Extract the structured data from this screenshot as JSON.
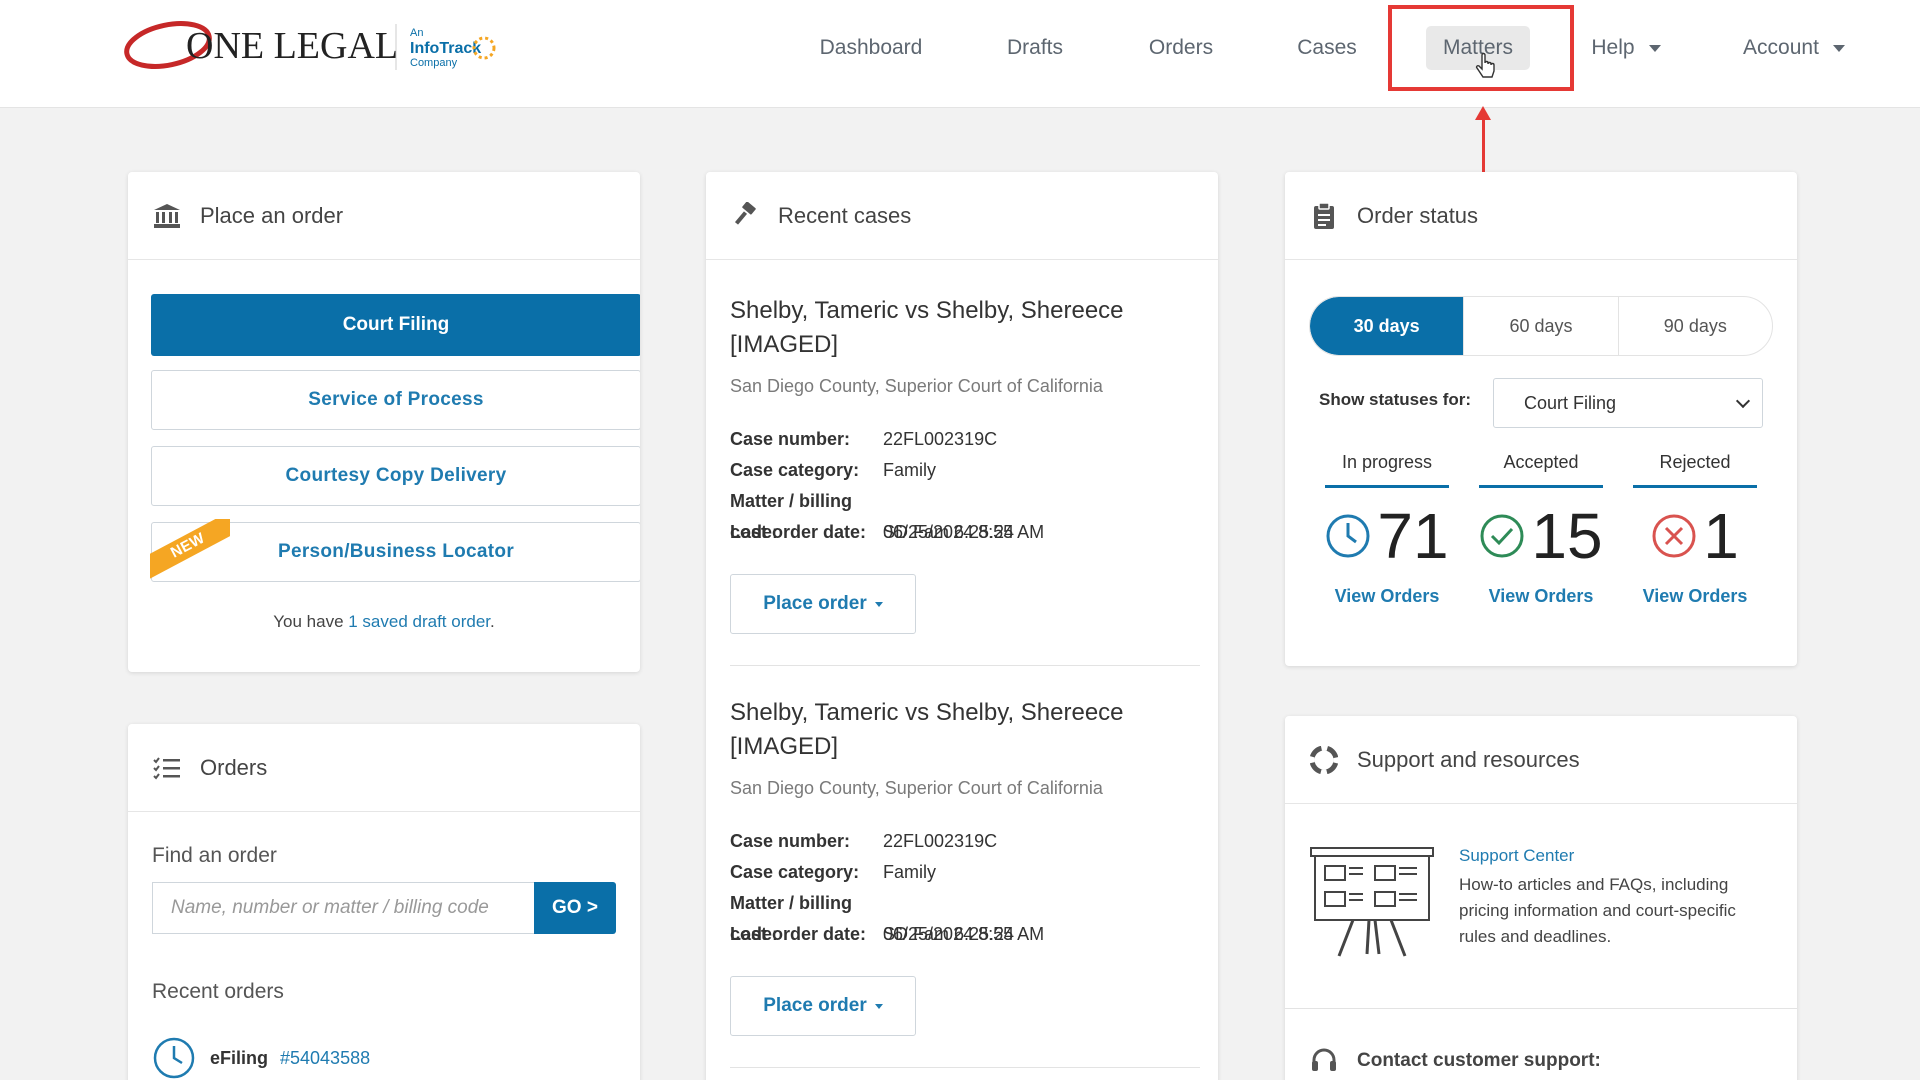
{
  "brand": {
    "logo_text": "ONE LEGAL",
    "partner_line1": "An",
    "partner_name": "InfoTrack",
    "partner_line2": "Company"
  },
  "nav": {
    "items": [
      "Dashboard",
      "Drafts",
      "Orders",
      "Cases",
      "Matters"
    ],
    "help": "Help",
    "account": "Account",
    "active": "Matters"
  },
  "place_order": {
    "title": "Place an order",
    "buttons": [
      "Court Filing",
      "Service of Process",
      "Courtesy Copy Delivery",
      "Person/Business Locator"
    ],
    "new_badge": "NEW",
    "saved_prefix": "You have ",
    "saved_link": "1 saved draft order",
    "saved_suffix": "."
  },
  "orders": {
    "title": "Orders",
    "find_label": "Find an order",
    "search_placeholder": "Name, number or matter / billing code",
    "go_label": "GO >",
    "recent_label": "Recent orders",
    "recent": [
      {
        "type": "eFiling",
        "number": "#54043588"
      }
    ]
  },
  "recent_cases": {
    "title": "Recent cases",
    "field_labels": {
      "case_number": "Case number:",
      "case_category": "Case category:",
      "matter_code": "Matter / billing code:",
      "last_order": "Last order date:"
    },
    "place_order_label": "Place order",
    "cases": [
      {
        "title": "Shelby, Tameric vs Shelby, Shereece [IMAGED]",
        "court": "San Diego County, Superior Court of California",
        "case_number": "22FL002319C",
        "case_category": "Family",
        "matter_code": "SD Fam 6.25.24",
        "last_order": "06/25/2024 8:55 AM"
      },
      {
        "title": "Shelby, Tameric vs Shelby, Shereece [IMAGED]",
        "court": "San Diego County, Superior Court of California",
        "case_number": "22FL002319C",
        "case_category": "Family",
        "matter_code": "SD Fam 6.25.24",
        "last_order": "06/25/2024 8:55 AM"
      }
    ]
  },
  "order_status": {
    "title": "Order status",
    "ranges": [
      "30 days",
      "60 days",
      "90 days"
    ],
    "active_range": "30 days",
    "show_label": "Show statuses for:",
    "selected_type": "Court Filing",
    "stats": [
      {
        "label": "In progress",
        "count": "71",
        "link": "View Orders",
        "icon": "clock-icon",
        "color": "#1f7bb0"
      },
      {
        "label": "Accepted",
        "count": "15",
        "link": "View Orders",
        "icon": "check-circle-icon",
        "color": "#2e8b57"
      },
      {
        "label": "Rejected",
        "count": "1",
        "link": "View Orders",
        "icon": "x-circle-icon",
        "color": "#d9534f"
      }
    ]
  },
  "support": {
    "title": "Support and resources",
    "center_link": "Support Center",
    "center_desc": "How-to articles and FAQs, including pricing information and court-specific rules and deadlines.",
    "contact_label": "Contact customer support:"
  },
  "colors": {
    "primary": "#0a6fa8",
    "link": "#1f7bb0",
    "highlight": "#e53935",
    "new_badge": "#f5a623"
  }
}
